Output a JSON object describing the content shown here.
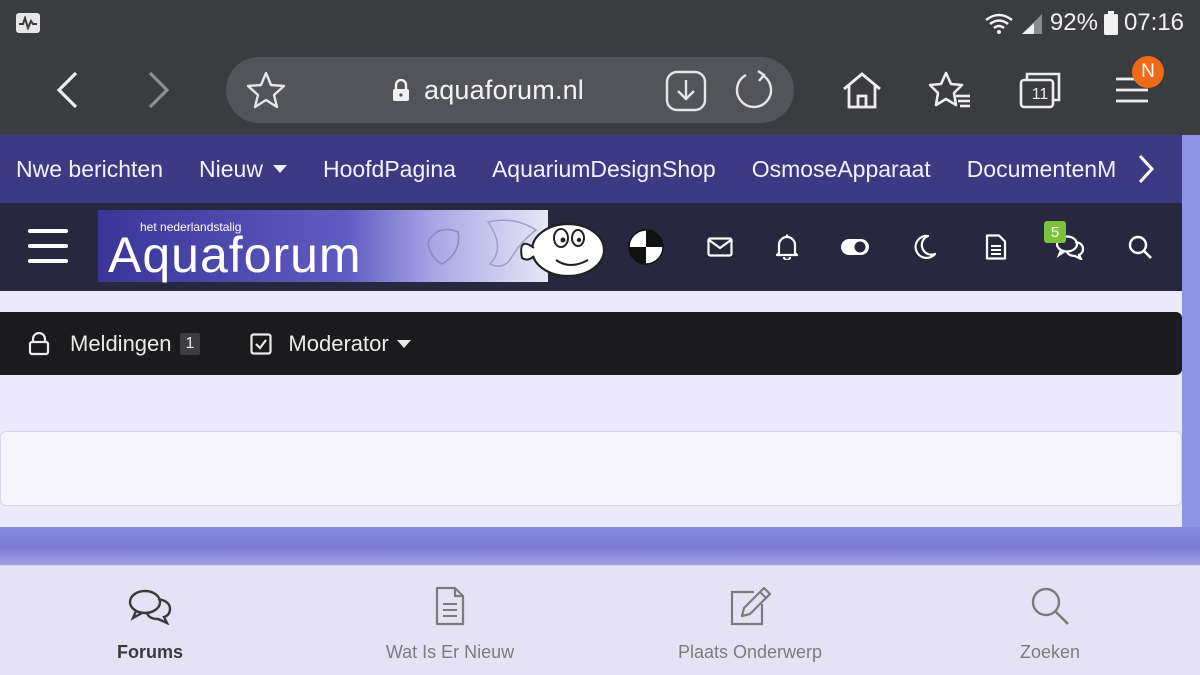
{
  "status_bar": {
    "battery": "92%",
    "time": "07:16"
  },
  "browser": {
    "url": "aquaforum.nl",
    "tab_count": "11",
    "profile_initial": "N"
  },
  "site_nav": {
    "items": [
      {
        "label": "Nwe berichten"
      },
      {
        "label": "Nieuw"
      },
      {
        "label": "HoofdPagina"
      },
      {
        "label": "AquariumDesignShop"
      },
      {
        "label": "OsmoseApparaat"
      },
      {
        "label": "DocumentenM"
      }
    ]
  },
  "header": {
    "logo_tagline": "het nederlandstalig",
    "logo_text": "Aquaforum",
    "conversations_badge": "5"
  },
  "moderator_bar": {
    "reports_label": "Meldingen",
    "reports_count": "1",
    "moderator_label": "Moderator"
  },
  "bottom_nav": {
    "items": [
      {
        "label": "Forums",
        "icon": "chat-bubbles-icon"
      },
      {
        "label": "Wat Is Er Nieuw",
        "icon": "document-icon"
      },
      {
        "label": "Plaats Onderwerp",
        "icon": "edit-icon"
      },
      {
        "label": "Zoeken",
        "icon": "search-icon"
      }
    ]
  },
  "colors": {
    "site_nav_bg": "#3c3a82",
    "header_bg": "#27273f",
    "mod_bar_bg": "#1b1b1d",
    "browser_bg": "#3a3c3f",
    "badge_orange": "#f06a16",
    "badge_green": "#7cc23a"
  }
}
